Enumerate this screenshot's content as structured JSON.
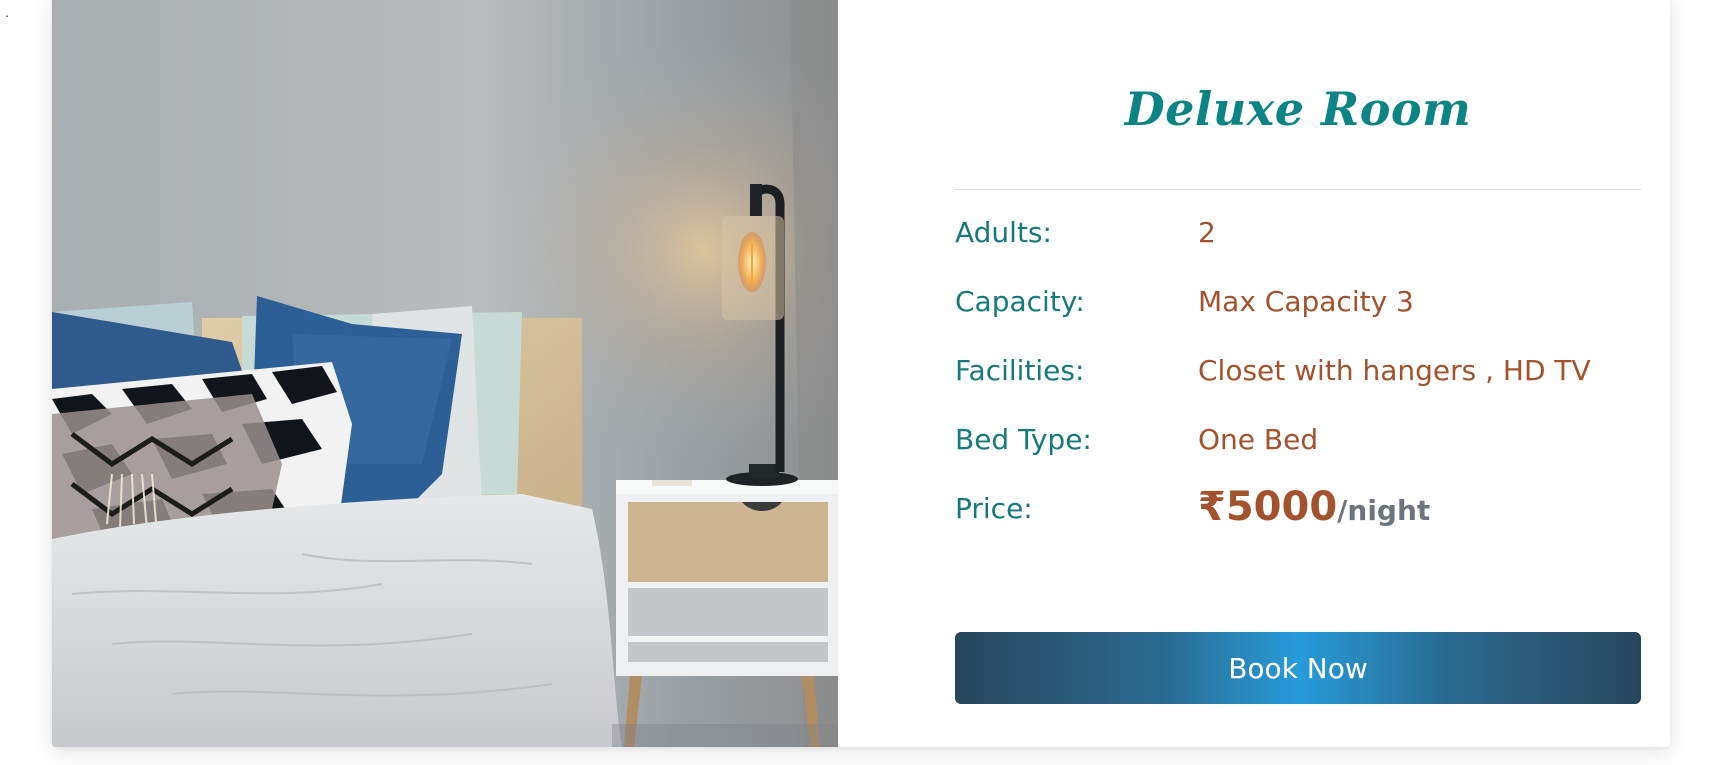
{
  "stray_mark": ".",
  "room": {
    "title": "Deluxe Room",
    "image_alt": "bedroom-with-lamp-photo"
  },
  "details": [
    {
      "label": "Adults:",
      "value": "2"
    },
    {
      "label": "Capacity:",
      "value": "Max Capacity 3"
    },
    {
      "label": "Facilities:",
      "value": "Closet with hangers , HD TV"
    },
    {
      "label": "Bed Type:",
      "value": "One Bed"
    }
  ],
  "price": {
    "label": "Price:",
    "amount": "₹5000",
    "unit": "/night"
  },
  "actions": {
    "book_label": "Book Now"
  },
  "colors": {
    "title": "#0d8484",
    "label": "#18797d",
    "value": "#a2532d",
    "unit": "#6c757d",
    "button_dark": "#27465c",
    "button_light": "#279bd9"
  }
}
